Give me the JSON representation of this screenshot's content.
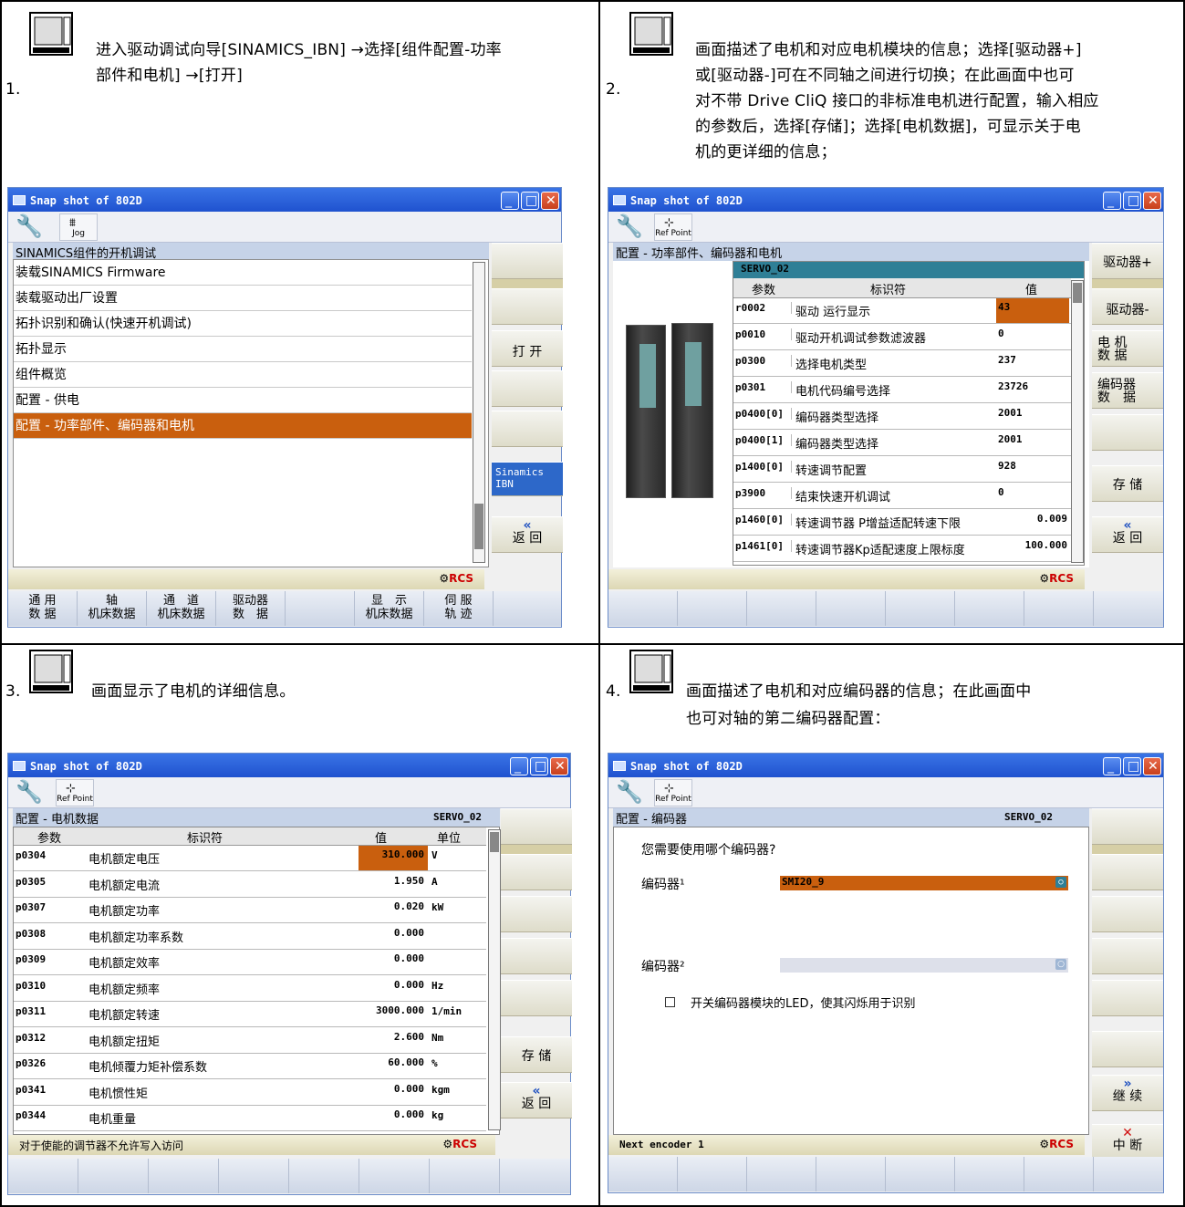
{
  "panels": [
    {
      "num": "1.",
      "desc_line1": "进入驱动调试向导[SINAMICS_IBN] →选择[组件配置-功率",
      "desc_line2": "部件和电机] →[打开]",
      "window_title": "Snap shot of 802D",
      "tool_button": "Jog",
      "header": "SINAMICS组件的开机调试",
      "list": [
        "装载SINAMICS Firmware",
        "装载驱动出厂设置",
        "拓扑识别和确认(快速开机调试)",
        "拓扑显示",
        "组件概览",
        "配置 - 供电",
        "配置 - 功率部件、编码器和电机"
      ],
      "softkeys": {
        "open": "打 开",
        "sinamics": "Sinamics IBN",
        "back": "返 回"
      },
      "bottom": [
        [
          "通 用",
          "数 据"
        ],
        [
          "轴",
          "机床数据"
        ],
        [
          "通　道",
          "机床数据"
        ],
        [
          "驱动器",
          "数　据"
        ],
        [
          "显　示",
          "机床数据"
        ],
        [
          "伺 服",
          "轨 迹"
        ]
      ]
    },
    {
      "num": "2.",
      "desc_lines": [
        "画面描述了电机和对应电机模块的信息；选择[驱动器+]",
        "或[驱动器-]可在不同轴之间进行切换；在此画面中也可",
        "对不带 Drive CliQ 接口的非标准电机进行配置，输入相应",
        "的参数后，选择[存储]；选择[电机数据]，可显示关于电",
        "机的更详细的信息；"
      ],
      "window_title": "Snap shot of 802D",
      "tool_button": "Ref Point",
      "header": "配置 - 功率部件、编码器和电机",
      "table_title": "SERVO_02",
      "cols": [
        "参数",
        "标识符",
        "值"
      ],
      "rows": [
        [
          "r0002",
          "驱动 运行显示",
          "43"
        ],
        [
          "p0010",
          "驱动开机调试参数滤波器",
          "0"
        ],
        [
          "p0300",
          "选择电机类型",
          "237"
        ],
        [
          "p0301",
          "电机代码编号选择",
          "23726"
        ],
        [
          "p0400[0]",
          "编码器类型选择",
          "2001"
        ],
        [
          "p0400[1]",
          "编码器类型选择",
          "2001"
        ],
        [
          "p1400[0]",
          "转速调节配置",
          "928"
        ],
        [
          "p3900",
          "结束快速开机调试",
          "0"
        ],
        [
          "p1460[0]",
          "转速调节器 P增益适配转速下限",
          "0.009"
        ],
        [
          "p1461[0]",
          "转速调节器Kp适配速度上限标度",
          "100.000"
        ]
      ],
      "softkeys": {
        "drive_plus": "驱动器+",
        "drive_minus": "驱动器-",
        "motor_data": "电 机\n数 据",
        "encoder_data": "编码器\n数　据",
        "store": "存 储",
        "back": "返 回"
      }
    },
    {
      "num": "3.",
      "desc": "画面显示了电机的详细信息。",
      "window_title": "Snap shot of 802D",
      "tool_button": "Ref Point",
      "header": "配置 - 电机数据",
      "header_right": "SERVO_02",
      "cols": [
        "参数",
        "标识符",
        "值",
        "单位"
      ],
      "rows": [
        [
          "p0304",
          "电机额定电压",
          "310.000",
          "V"
        ],
        [
          "p0305",
          "电机额定电流",
          "1.950",
          "A"
        ],
        [
          "p0307",
          "电机额定功率",
          "0.020",
          "kW"
        ],
        [
          "p0308",
          "电机额定功率系数",
          "0.000",
          ""
        ],
        [
          "p0309",
          "电机额定效率",
          "0.000",
          ""
        ],
        [
          "p0310",
          "电机额定频率",
          "0.000",
          "Hz"
        ],
        [
          "p0311",
          "电机额定转速",
          "3000.000",
          "1/min"
        ],
        [
          "p0312",
          "电机额定扭矩",
          "2.600",
          "Nm"
        ],
        [
          "p0326",
          "电机倾覆力矩补偿系数",
          "60.000",
          "%"
        ],
        [
          "p0341",
          "电机惯性矩",
          "0.000",
          "kgm"
        ],
        [
          "p0344",
          "电机重量",
          "0.000",
          "kg"
        ]
      ],
      "status": "对于使能的调节器不允许写入访问",
      "softkeys": {
        "store": "存 储",
        "back": "返 回"
      }
    },
    {
      "num": "4.",
      "desc_line1": "画面描述了电机和对应编码器的信息；在此画面中",
      "desc_line2": "也可对轴的第二编码器配置：",
      "window_title": "Snap shot of 802D",
      "tool_button": "Ref Point",
      "header": "配置 - 编码器",
      "header_right": "SERVO_02",
      "question": "您需要使用哪个编码器?",
      "enc1_label": "编码器¹",
      "enc1_value": "SMI20_9",
      "enc2_label": "编码器²",
      "enc2_value": "",
      "checkbox_label": "开关编码器模块的LED，使其闪烁用于识别",
      "status": "Next encoder 1",
      "softkeys": {
        "continue": "继 续",
        "abort": "中 断"
      }
    }
  ],
  "colors": {
    "accent": "#c95f0e",
    "titlebar": "#2a62d8",
    "header": "#2f7f96"
  }
}
